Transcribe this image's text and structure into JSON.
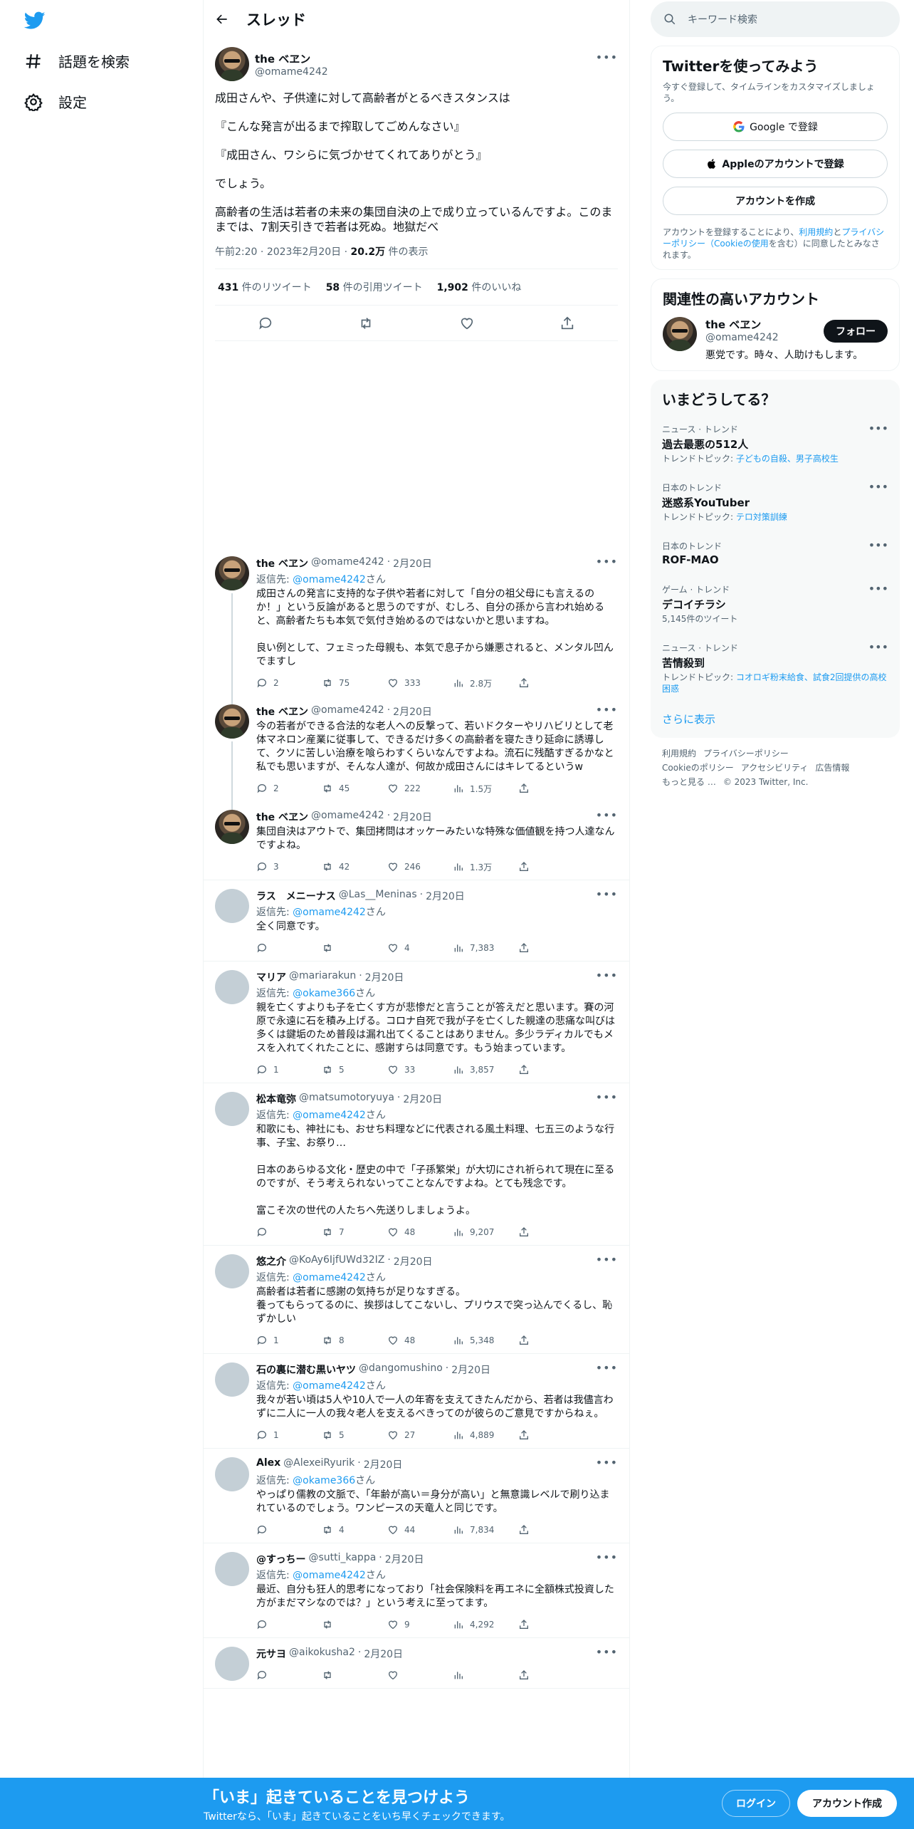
{
  "nav": {
    "explore": "話題を検索",
    "settings": "設定"
  },
  "header": {
    "title": "スレッド"
  },
  "focus_tweet": {
    "name": "the ベヱン",
    "handle": "@omame4242",
    "paragraphs": [
      "成田さんや、子供達に対して高齢者がとるべきスタンスは",
      "『こんな発言が出るまで搾取してごめんなさい』",
      "『成田さん、ワシらに気づかせてくれてありがとう』",
      "でしょう。",
      "高齢者の生活は若者の未来の集団自決の上で成り立っているんですよ。このままでは、7割天引きで若者は死ぬ。地獄だべ"
    ],
    "time": "午前2:20",
    "date": "2023年2月20日",
    "views_count": "20.2万",
    "views_label": " 件の表示",
    "retweets_count": "431",
    "retweets_label": " 件のリツイート",
    "quotes_count": "58",
    "quotes_label": " 件の引用ツイート",
    "likes_count": "1,902",
    "likes_label": " 件のいいね"
  },
  "tweets": [
    {
      "name": "the ベヱン",
      "handle": "@omame4242",
      "date": "2月20日",
      "reply_prefix": "返信先: ",
      "reply_to": "@omame4242",
      "reply_suffix": "さん",
      "text": "成田さんの発言に支持的な子供や若者に対して「自分の祖父母にも言えるのか！」という反論があると思うのですが、むしろ、自分の孫から言われ始めると、高齢者たちも本気で気付き始めるのではないかと思いますね。\n\n良い例として、フェミった母親も、本気で息子から嫌悪されると、メンタル凹んでますし",
      "replies": "2",
      "retweets": "75",
      "likes": "333",
      "views": "2.8万"
    },
    {
      "name": "the ベヱン",
      "handle": "@omame4242",
      "date": "2月20日",
      "text": "今の若者ができる合法的な老人への反撃って、若いドクターやリハビリとして老体マネロン産業に従事して、できるだけ多くの高齢者を寝たきり延命に誘導して、クソに苦しい治療を喰らわすくらいなんですよね。流石に残酷すぎるかなと私でも思いますが、そんな人達が、何故か成田さんにはキレてるというw",
      "replies": "2",
      "retweets": "45",
      "likes": "222",
      "views": "1.5万"
    },
    {
      "name": "the ベヱン",
      "handle": "@omame4242",
      "date": "2月20日",
      "text": "集団自決はアウトで、集団拷問はオッケーみたいな特殊な価値観を持つ人達なんですよね。",
      "replies": "3",
      "retweets": "42",
      "likes": "246",
      "views": "1.3万"
    },
    {
      "name": "ラス　メニーナス",
      "handle": "@Las__Meninas",
      "date": "2月20日",
      "reply_prefix": "返信先: ",
      "reply_to": "@omame4242",
      "reply_suffix": "さん",
      "text": "全く同意です。",
      "replies": "",
      "retweets": "",
      "likes": "4",
      "views": "7,383"
    },
    {
      "name": "マリア",
      "handle": "@mariarakun",
      "date": "2月20日",
      "reply_prefix": "返信先: ",
      "reply_to": "@okame366",
      "reply_suffix": "さん",
      "text": "親を亡くすよりも子を亡くす方が悲惨だと言うことが答えだと思います。賽の河原で永遠に石を積み上げる。コロナ自死で我が子を亡くした親達の悲痛な叫びは多くは鍵垢のため普段は漏れ出てくることはありません。多少ラディカルでもメスを入れてくれたことに、感謝すらは同意です。もう始まっています。",
      "replies": "1",
      "retweets": "5",
      "likes": "33",
      "views": "3,857"
    },
    {
      "name": "松本竜弥",
      "handle": "@matsumotoryuya",
      "date": "2月20日",
      "reply_prefix": "返信先: ",
      "reply_to": "@omame4242",
      "reply_suffix": "さん",
      "text": "和歌にも、神社にも、おせち料理などに代表される風土料理、七五三のような行事、子宝、お祭り…\n\n日本のあらゆる文化・歴史の中で「子孫繁栄」が大切にされ祈られて現在に至るのですが、そう考えられないってことなんですよね。とても残念です。\n\n富こそ次の世代の人たちへ先送りしましょうよ。",
      "replies": "",
      "retweets": "7",
      "likes": "48",
      "views": "9,207"
    },
    {
      "name": "悠之介",
      "handle": "@KoAy6IjfUWd32IZ",
      "date": "2月20日",
      "reply_prefix": "返信先: ",
      "reply_to": "@omame4242",
      "reply_suffix": "さん",
      "text": "高齢者は若者に感謝の気持ちが足りなすぎる。\n養ってもらってるのに、挨拶はしてこないし、プリウスで突っ込んでくるし、恥ずかしい",
      "replies": "1",
      "retweets": "8",
      "likes": "48",
      "views": "5,348"
    },
    {
      "name": "石の裏に潜む黒いヤツ",
      "handle": "@dangomushino",
      "date": "2月20日",
      "reply_prefix": "返信先: ",
      "reply_to": "@omame4242",
      "reply_suffix": "さん",
      "text": "我々が若い頃は5人や10人で一人の年寄を支えてきたんだから、若者は我儘言わずに二人に一人の我々老人を支えるべきってのが彼らのご意見ですからねぇ。",
      "replies": "1",
      "retweets": "5",
      "likes": "27",
      "views": "4,889"
    },
    {
      "name": "Alex",
      "handle": "@AlexeiRyurik",
      "date": "2月20日",
      "reply_prefix": "返信先: ",
      "reply_to": "@okame366",
      "reply_suffix": "さん",
      "text": "やっぱり儒教の文脈で、「年齢が高い＝身分が高い」と無意識レベルで刷り込まれているのでしょう。ワンピースの天竜人と同じです。",
      "replies": "",
      "retweets": "4",
      "likes": "44",
      "views": "7,834"
    },
    {
      "name": "@すっちー",
      "handle": "@sutti_kappa",
      "date": "2月20日",
      "reply_prefix": "返信先: ",
      "reply_to": "@omame4242",
      "reply_suffix": "さん",
      "text": "最近、自分も狂人的思考になっており「社会保険料を再エネに全額株式投資した方がまだマシなのでは？」という考えに至ってます。",
      "replies": "",
      "retweets": "",
      "likes": "9",
      "views": "4,292"
    },
    {
      "name": "元サヨ",
      "handle": "@aikokusha2",
      "date": "2月20日",
      "text": "",
      "replies": "",
      "retweets": "",
      "likes": "",
      "views": ""
    }
  ],
  "sidebar": {
    "search_placeholder": "キーワード検索",
    "signup": {
      "title": "Twitterを使ってみよう",
      "subtitle": "今すぐ登録して、タイムラインをカスタマイズしましょう。",
      "google": "Google で登録",
      "apple": "Appleのアカウントで登録",
      "create": "アカウントを作成",
      "terms_1": "アカウントを登録することにより、",
      "terms_link_1": "利用規約",
      "terms_2": "と",
      "terms_link_2": "プライバシーポリシー（Cookieの使用",
      "terms_3": "を含む）に同意したとみなされます。"
    },
    "related": {
      "title": "関連性の高いアカウント",
      "name": "the ベヱン",
      "handle": "@omame4242",
      "follow": "フォロー",
      "bio": "悪党です。時々、人助けもします。"
    },
    "trends": {
      "title": "いまどうしてる？",
      "items": [
        {
          "category": "ニュース · トレンド",
          "title": "過去最悪の512人",
          "sub_label": "トレンドトピック: ",
          "sub_link": "子どもの自殺、男子高校生"
        },
        {
          "category": "日本のトレンド",
          "title": "迷惑系YouTuber",
          "sub_label": "トレンドトピック: ",
          "sub_link": "テロ対策訓練"
        },
        {
          "category": "日本のトレンド",
          "title": "ROF-MAO",
          "sub_label": "",
          "sub_link": ""
        },
        {
          "category": "ゲーム · トレンド",
          "title": "デコイチラシ",
          "sub_label": "5,145件のツイート",
          "sub_link": ""
        },
        {
          "category": "ニュース · トレンド",
          "title": "苦情殺到",
          "sub_label": "トレンドトピック: ",
          "sub_link": "コオロギ粉末給食、試食2回提供の高校困惑"
        }
      ],
      "show_more": "さらに表示"
    },
    "footer": {
      "links": [
        "利用規約",
        "プライバシーポリシー",
        "Cookieのポリシー",
        "アクセシビリティ",
        "広告情報",
        "もっと見る …"
      ],
      "copyright": "© 2023 Twitter, Inc."
    }
  },
  "bottom_bar": {
    "headline": "「いま」起きていることを見つけよう",
    "sub": "Twitterなら、「いま」起きていることをいち早くチェックできます。",
    "login": "ログイン",
    "signup": "アカウント作成"
  },
  "colors": {
    "accent": "#1d9bf0",
    "text": "#0f1419",
    "muted": "#536471",
    "border": "#eff3f4"
  }
}
